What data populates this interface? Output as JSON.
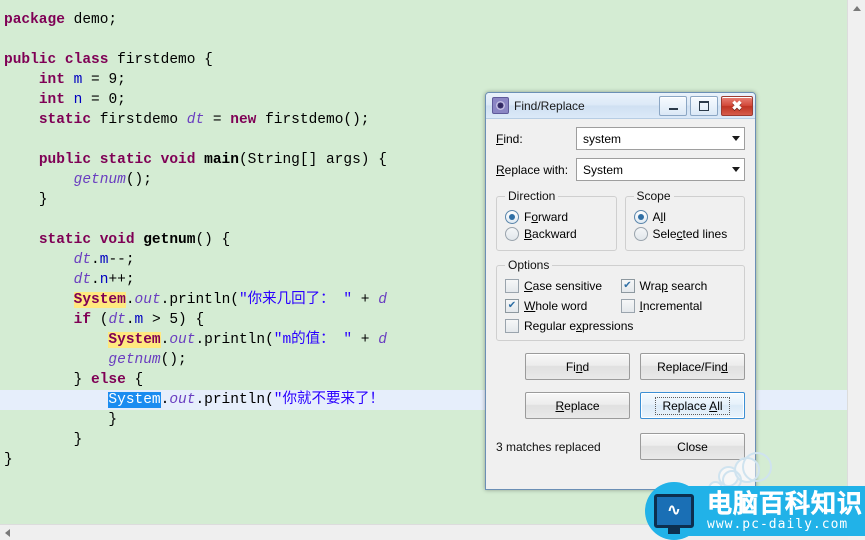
{
  "editor": {
    "background_color": "#d4ecd3",
    "current_line_color": "#e6eefb",
    "match_highlight_color": "#ffe97f",
    "selection_color": "#1b8cf0",
    "lines": [
      {
        "indent": 0,
        "segments": [
          {
            "t": "package",
            "c": "kw"
          },
          {
            "t": " demo;",
            "c": "plain"
          }
        ]
      },
      {
        "indent": 0,
        "segments": []
      },
      {
        "indent": 0,
        "segments": [
          {
            "t": "public class",
            "c": "kw"
          },
          {
            "t": " firstdemo {",
            "c": "plain"
          }
        ]
      },
      {
        "indent": 1,
        "segments": [
          {
            "t": "int",
            "c": "kw"
          },
          {
            "t": " ",
            "c": "plain"
          },
          {
            "t": "m",
            "c": "fld"
          },
          {
            "t": " = ",
            "c": "plain"
          },
          {
            "t": "9;",
            "c": "plain"
          }
        ]
      },
      {
        "indent": 1,
        "segments": [
          {
            "t": "int",
            "c": "kw"
          },
          {
            "t": " ",
            "c": "plain"
          },
          {
            "t": "n",
            "c": "fld"
          },
          {
            "t": " = ",
            "c": "plain"
          },
          {
            "t": "0;",
            "c": "plain"
          }
        ]
      },
      {
        "indent": 1,
        "segments": [
          {
            "t": "static",
            "c": "kw"
          },
          {
            "t": " firstdemo ",
            "c": "plain"
          },
          {
            "t": "dt",
            "c": "fld-i"
          },
          {
            "t": " = ",
            "c": "plain"
          },
          {
            "t": "new",
            "c": "kw"
          },
          {
            "t": " firstdemo();",
            "c": "plain"
          }
        ]
      },
      {
        "indent": 0,
        "segments": []
      },
      {
        "indent": 1,
        "segments": [
          {
            "t": "public static void",
            "c": "kw"
          },
          {
            "t": " ",
            "c": "plain"
          },
          {
            "t": "main",
            "c": "bold"
          },
          {
            "t": "(String[] args) {",
            "c": "plain"
          }
        ]
      },
      {
        "indent": 2,
        "segments": [
          {
            "t": "getnum",
            "c": "loc"
          },
          {
            "t": "();",
            "c": "plain"
          }
        ]
      },
      {
        "indent": 1,
        "segments": [
          {
            "t": "}",
            "c": "plain"
          }
        ]
      },
      {
        "indent": 0,
        "segments": []
      },
      {
        "indent": 1,
        "segments": [
          {
            "t": "static void",
            "c": "kw"
          },
          {
            "t": " ",
            "c": "plain"
          },
          {
            "t": "getnum",
            "c": "bold"
          },
          {
            "t": "() {",
            "c": "plain"
          }
        ]
      },
      {
        "indent": 2,
        "segments": [
          {
            "t": "dt",
            "c": "fld-i"
          },
          {
            "t": ".",
            "c": "plain"
          },
          {
            "t": "m",
            "c": "fld"
          },
          {
            "t": "--;",
            "c": "plain"
          }
        ]
      },
      {
        "indent": 2,
        "segments": [
          {
            "t": "dt",
            "c": "fld-i"
          },
          {
            "t": ".",
            "c": "plain"
          },
          {
            "t": "n",
            "c": "fld"
          },
          {
            "t": "++;",
            "c": "plain"
          }
        ]
      },
      {
        "indent": 2,
        "segments": [
          {
            "t": "System",
            "c": "hl"
          },
          {
            "t": ".",
            "c": "plain"
          },
          {
            "t": "out",
            "c": "fld-i"
          },
          {
            "t": ".println(",
            "c": "plain"
          },
          {
            "t": "\"你来几回了： \"",
            "c": "str"
          },
          {
            "t": " + ",
            "c": "plain"
          },
          {
            "t": "d",
            "c": "fld-i"
          }
        ]
      },
      {
        "indent": 2,
        "segments": [
          {
            "t": "if",
            "c": "kw"
          },
          {
            "t": " (",
            "c": "plain"
          },
          {
            "t": "dt",
            "c": "fld-i"
          },
          {
            "t": ".",
            "c": "plain"
          },
          {
            "t": "m",
            "c": "fld"
          },
          {
            "t": " > 5) {",
            "c": "plain"
          }
        ]
      },
      {
        "indent": 3,
        "segments": [
          {
            "t": "System",
            "c": "hl"
          },
          {
            "t": ".",
            "c": "plain"
          },
          {
            "t": "out",
            "c": "fld-i"
          },
          {
            "t": ".println(",
            "c": "plain"
          },
          {
            "t": "\"m的值： \"",
            "c": "str"
          },
          {
            "t": " + ",
            "c": "plain"
          },
          {
            "t": "d",
            "c": "fld-i"
          }
        ]
      },
      {
        "indent": 3,
        "segments": [
          {
            "t": "getnum",
            "c": "loc"
          },
          {
            "t": "();",
            "c": "plain"
          }
        ]
      },
      {
        "indent": 2,
        "segments": [
          {
            "t": "} ",
            "c": "plain"
          },
          {
            "t": "else",
            "c": "kw"
          },
          {
            "t": " {",
            "c": "plain"
          }
        ]
      },
      {
        "indent": 3,
        "current": true,
        "segments": [
          {
            "t": "System",
            "c": "sel"
          },
          {
            "t": ".",
            "c": "plain"
          },
          {
            "t": "out",
            "c": "fld-i"
          },
          {
            "t": ".println(",
            "c": "plain"
          },
          {
            "t": "\"你就不要来了！",
            "c": "str"
          }
        ]
      },
      {
        "indent": 3,
        "segments": [
          {
            "t": "}",
            "c": "plain"
          }
        ]
      },
      {
        "indent": 2,
        "segments": [
          {
            "t": "}",
            "c": "plain"
          }
        ]
      },
      {
        "indent": 0,
        "segments": [
          {
            "t": "}",
            "c": "plain"
          }
        ]
      }
    ]
  },
  "scrollbars": {
    "vertical_up_icon": "triangle-up-icon",
    "horizontal_left_icon": "triangle-left-icon"
  },
  "dialog": {
    "title": "Find/Replace",
    "title_icon": "gear-icon",
    "window_buttons": {
      "minimize": "minimize-icon",
      "maximize": "maximize-icon",
      "close": "close-icon",
      "close_glyph": "✖"
    },
    "find": {
      "label": "Find:",
      "label_mnemonic": "F",
      "value": "system",
      "dropdown_icon": "chevron-down-icon"
    },
    "replace": {
      "label": "Replace with:",
      "label_mnemonic": "R",
      "value": "System",
      "dropdown_icon": "chevron-down-icon"
    },
    "direction": {
      "legend": "Direction",
      "options": [
        {
          "label": "Forward",
          "mnemonic": "o",
          "selected": true
        },
        {
          "label": "Backward",
          "mnemonic": "B",
          "selected": false
        }
      ]
    },
    "scope": {
      "legend": "Scope",
      "options": [
        {
          "label": "All",
          "mnemonic": "l",
          "selected": true
        },
        {
          "label": "Selected lines",
          "mnemonic": "c",
          "selected": false
        }
      ]
    },
    "options": {
      "legend": "Options",
      "items": [
        {
          "label": "Case sensitive",
          "mnemonic": "C",
          "checked": false,
          "full": false
        },
        {
          "label": "Wrap search",
          "mnemonic": "p",
          "checked": true,
          "full": false
        },
        {
          "label": "Whole word",
          "mnemonic": "W",
          "checked": true,
          "full": false
        },
        {
          "label": "Incremental",
          "mnemonic": "I",
          "checked": false,
          "full": false
        },
        {
          "label": "Regular expressions",
          "mnemonic": "x",
          "checked": false,
          "full": true
        }
      ],
      "check_glyph": "✔"
    },
    "buttons": {
      "find": "Find",
      "replace_find": "Replace/Find",
      "replace": "Replace",
      "replace_all": "Replace All",
      "close": "Close"
    },
    "status": "3 matches replaced",
    "focused_button": "Replace All",
    "focus_border_color": "#3c8fd4"
  },
  "watermark": {
    "brand_cn": "电脑百科知识",
    "url": "www.pc-daily.com",
    "icon": "monitor-pulse-icon",
    "wave_glyph": "∿",
    "color": "#21b2e8"
  }
}
